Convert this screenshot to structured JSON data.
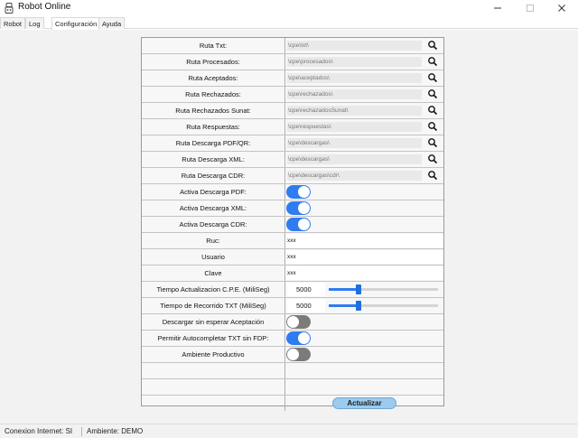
{
  "window": {
    "title": "Robot Online"
  },
  "tabs": [
    {
      "label": "Robot"
    },
    {
      "label": "Log"
    },
    {
      "label": "Configuración"
    },
    {
      "label": "Ayuda"
    }
  ],
  "active_tab": "Configuración",
  "config": {
    "paths": [
      {
        "label": "Ruta Txt:",
        "value": "\\cpe\\txt\\"
      },
      {
        "label": "Ruta Procesados:",
        "value": "\\cpe\\procesados\\"
      },
      {
        "label": "Ruta Aceptados:",
        "value": "\\cpe\\aceptados\\"
      },
      {
        "label": "Ruta Rechazados:",
        "value": "\\cpe\\rechazados\\"
      },
      {
        "label": "Ruta Rechazados Sunat:",
        "value": "\\cpe\\rechazadosSunat\\"
      },
      {
        "label": "Ruta Respuestas:",
        "value": "\\cpe\\respuestas\\"
      },
      {
        "label": "Ruta Descarga PDF/QR:",
        "value": "\\cpe\\descargas\\"
      },
      {
        "label": "Ruta Descarga XML:",
        "value": "\\cpe\\descargas\\"
      },
      {
        "label": "Ruta Descarga CDR:",
        "value": "\\cpe\\descargas\\cdr\\"
      }
    ],
    "download_toggles": [
      {
        "label": "Activa Descarga PDF:",
        "on": true
      },
      {
        "label": "Activa Descarga XML:",
        "on": true
      },
      {
        "label": "Activa Descarga CDR:",
        "on": true
      }
    ],
    "credentials": [
      {
        "label": "Ruc:",
        "value": "xxx"
      },
      {
        "label": "Usuario",
        "value": "xxx"
      },
      {
        "label": "Clave",
        "value": "xxx"
      }
    ],
    "timers": [
      {
        "label": "Tiempo Actualizacion C.P.E. (MiliSeg)",
        "value": "5000",
        "slider_fraction": 0.27
      },
      {
        "label": "Tiempo de Recorrido TXT (MiliSeg)",
        "value": "5000",
        "slider_fraction": 0.27
      }
    ],
    "flags": [
      {
        "label": "Descargar sin esperar Aceptación",
        "on": false
      },
      {
        "label": "Permitir Autocompletar TXT sin FDP:",
        "on": true
      },
      {
        "label": "Ambiente Productivo",
        "on": false
      }
    ],
    "update_button": "Actualizar"
  },
  "status": {
    "internet": "Conexion Internet: SI",
    "environment": "Ambiente: DEMO"
  },
  "colors": {
    "toggle_on": "#2e7cf0",
    "toggle_off": "#7b7b7b",
    "update_button": "#9ccbee"
  },
  "icons": {
    "app": "robot-app-icon",
    "search": "search-icon"
  }
}
